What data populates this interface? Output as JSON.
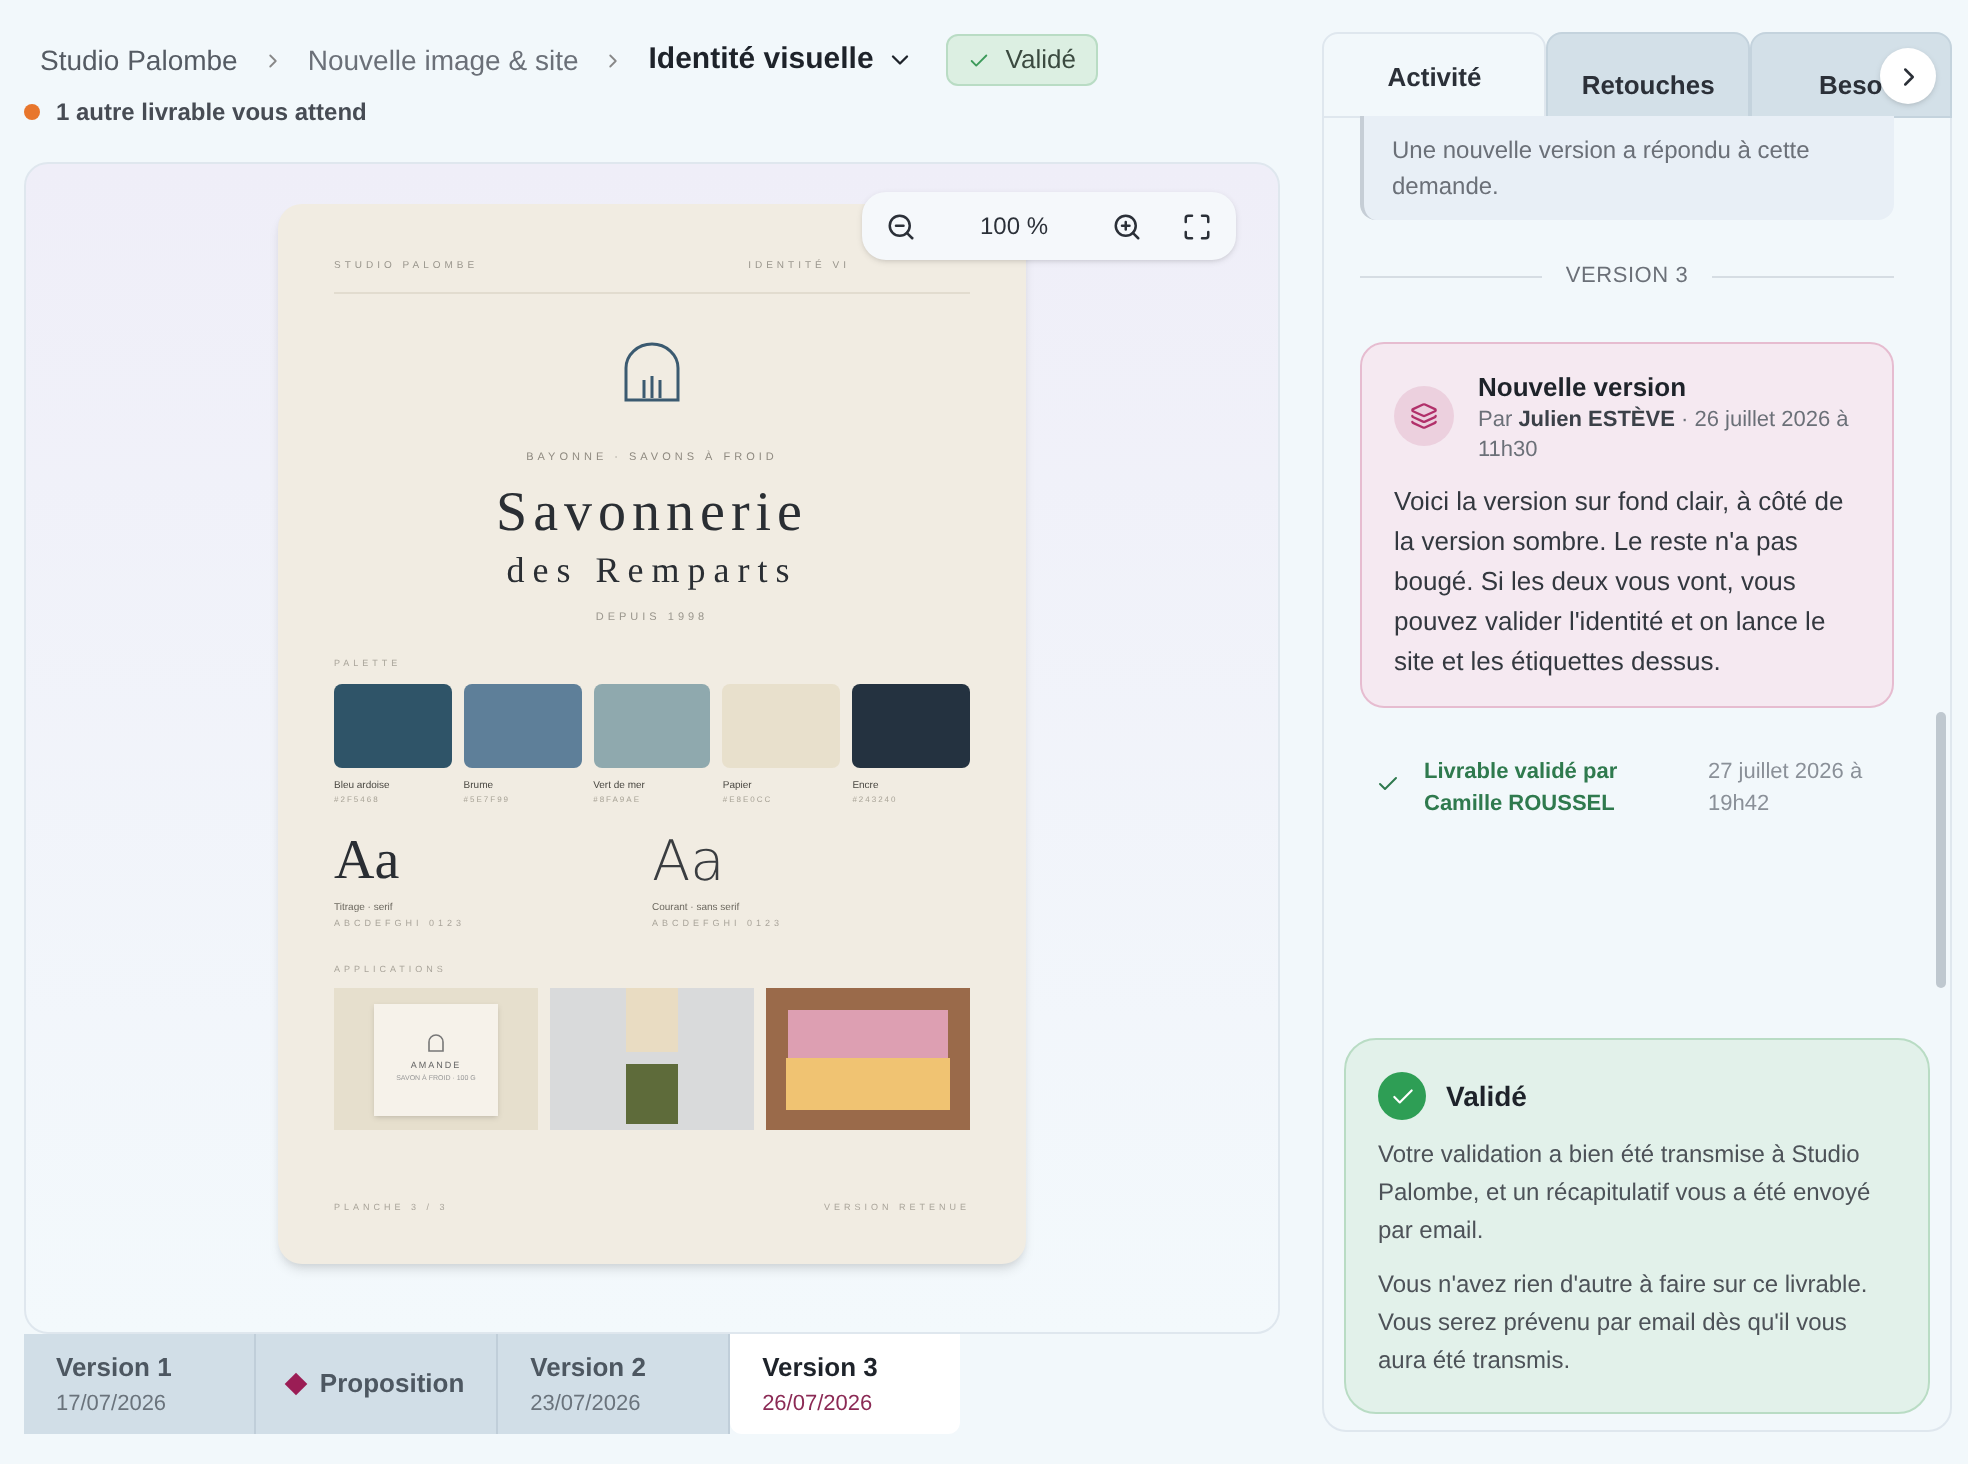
{
  "breadcrumb": {
    "items": [
      "Studio Palombe",
      "Nouvelle image & site"
    ],
    "current": "Identité visuelle",
    "status": "Validé"
  },
  "notice": {
    "text": "1 autre livrable vous attend",
    "color": "#e8762c"
  },
  "zoom": {
    "value": "100 %"
  },
  "document": {
    "header_left": "STUDIO PALOMBE",
    "header_right": "IDENTITÉ VI",
    "tagline": "BAYONNE · SAVONS À FROID",
    "title": "Savonnerie",
    "subtitle": "des Remparts",
    "since": "DEPUIS 1998",
    "palette_label": "PALETTE",
    "swatches": [
      {
        "name": "Bleu ardoise",
        "code": "#2F5468",
        "color": "#2f5468"
      },
      {
        "name": "Brume",
        "code": "#5E7F99",
        "color": "#5e7f99"
      },
      {
        "name": "Vert de mer",
        "code": "#8FA9AE",
        "color": "#8fa9ae"
      },
      {
        "name": "Papier",
        "code": "#E8E0CC",
        "color": "#e8e0cc"
      },
      {
        "name": "Encre",
        "code": "#243240",
        "color": "#243240"
      }
    ],
    "fonts": [
      {
        "kind": "serif",
        "sample": "Aa",
        "label": "Titrage · serif",
        "alphabet": "ABCDEFGHI 0123"
      },
      {
        "kind": "sans",
        "sample": "Aa",
        "label": "Courant · sans serif",
        "alphabet": "ABCDEFGHI 0123"
      }
    ],
    "applications_label": "APPLICATIONS",
    "label_card": {
      "name": "AMANDE",
      "detail": "SAVON À FROID · 100 G"
    },
    "footer_left": "PLANCHE 3 / 3",
    "footer_right": "VERSION RETENUE"
  },
  "versions": [
    {
      "kind": "version",
      "label": "Version 1",
      "date": "17/07/2026",
      "selected": false
    },
    {
      "kind": "proposal",
      "label": "Proposition",
      "selected": false
    },
    {
      "kind": "version",
      "label": "Version 2",
      "date": "23/07/2026",
      "selected": false
    },
    {
      "kind": "version",
      "label": "Version 3",
      "date": "26/07/2026",
      "selected": true
    }
  ],
  "panel": {
    "tabs": [
      {
        "label": "Activité",
        "selected": true
      },
      {
        "label": "Retouches",
        "selected": false
      },
      {
        "label": "Beso",
        "selected": false
      }
    ],
    "previous_note": "Une nouvelle version a répondu à cette demande.",
    "divider": "VERSION 3",
    "event": {
      "title": "Nouvelle version",
      "by": "Par",
      "author": "Julien ESTÈVE",
      "date": "· 26 juillet 2026 à 11h30",
      "body": "Voici la version sur fond clair, à côté de la version sombre. Le reste n'a pas bougé. Si les deux vous vont, vous pouvez valider l'identité et on lance le site et les étiquettes dessus."
    },
    "validation": {
      "text": "Livrable validé par Camille ROUSSEL",
      "date": "27 juillet 2026 à 19h42"
    },
    "status_card": {
      "title": "Validé",
      "paragraphs": [
        "Votre validation a bien été transmise à Studio Palombe, et un récapitulatif vous a été envoyé par email.",
        "Vous n'avez rien d'autre à faire sur ce livrable. Vous serez prévenu par email dès qu'il vous aura été transmis."
      ]
    }
  }
}
